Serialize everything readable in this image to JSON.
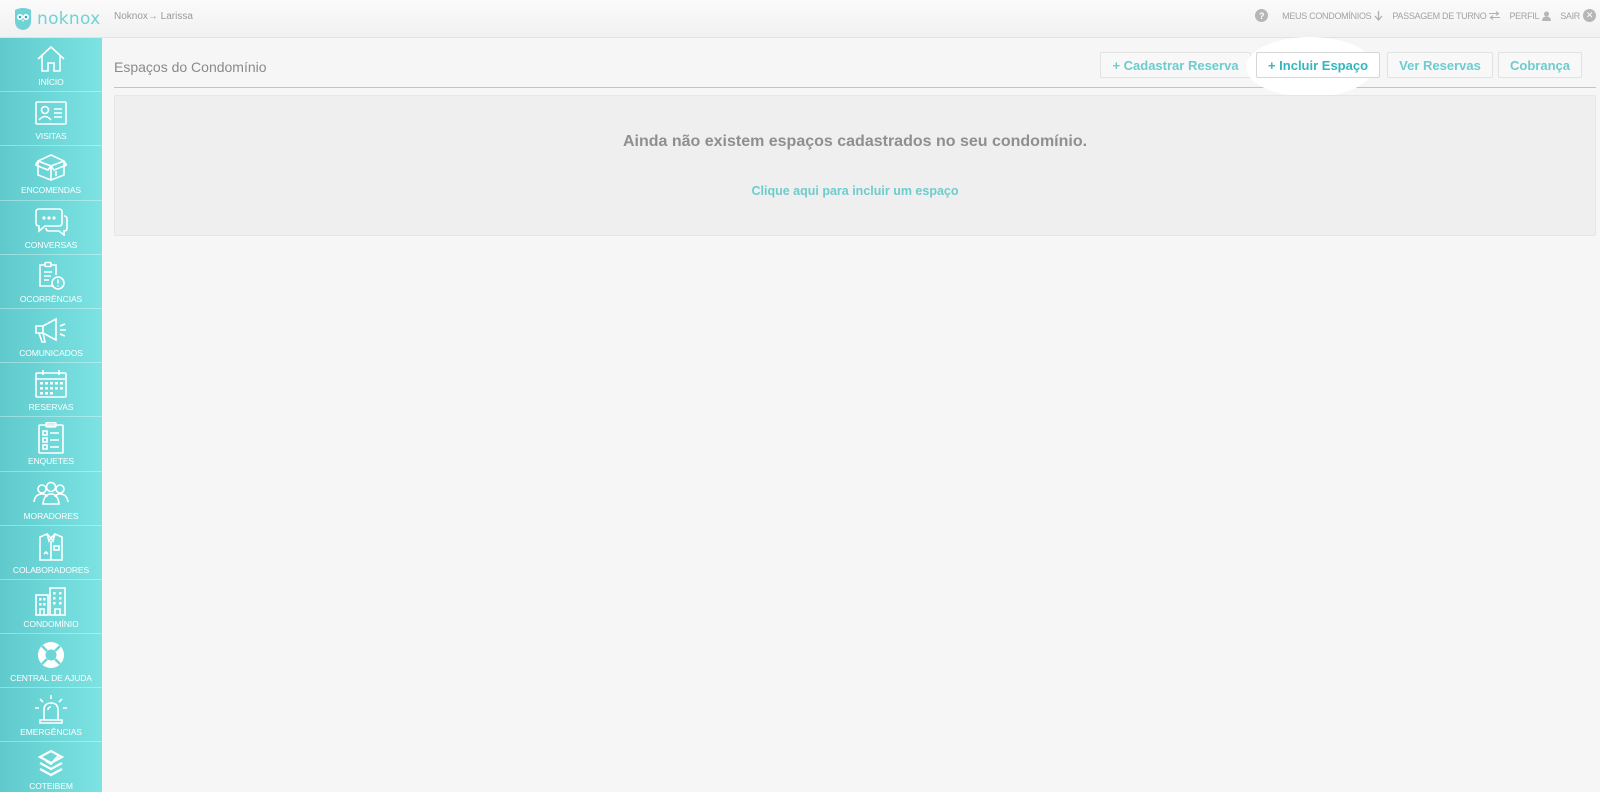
{
  "app": {
    "logo_text": "noknox",
    "breadcrumb": "Noknox→ Larissa"
  },
  "topnav": {
    "help_glyph": "?",
    "meus_condominios": "MEUS CONDOMÍNIOS",
    "passagem_de_turno": "PASSAGEM DE TURNO",
    "perfil": "PERFIL",
    "sair": "SAIR"
  },
  "sidebar": {
    "items": [
      {
        "label": "INÍCIO",
        "icon": "home-icon"
      },
      {
        "label": "VISITAS",
        "icon": "id-card-icon"
      },
      {
        "label": "ENCOMENDAS",
        "icon": "package-icon"
      },
      {
        "label": "CONVERSAS",
        "icon": "chat-icon"
      },
      {
        "label": "OCORRÊNCIAS",
        "icon": "clipboard-alert-icon"
      },
      {
        "label": "COMUNICADOS",
        "icon": "megaphone-icon"
      },
      {
        "label": "RESERVAS",
        "icon": "calendar-icon"
      },
      {
        "label": "ENQUETES",
        "icon": "checklist-icon"
      },
      {
        "label": "MORADORES",
        "icon": "people-icon"
      },
      {
        "label": "COLABORADORES",
        "icon": "staff-icon"
      },
      {
        "label": "CONDOMÍNIO",
        "icon": "building-icon"
      },
      {
        "label": "CENTRAL DE AJUDA",
        "icon": "lifebuoy-icon"
      },
      {
        "label": "EMERGÊNCIAS",
        "icon": "siren-icon"
      },
      {
        "label": "COTEIBEM",
        "icon": "coteibem-icon"
      }
    ]
  },
  "main": {
    "title": "Espaços do Condomínio",
    "buttons": {
      "cadastrar_reserva": "+ Cadastrar Reserva",
      "incluir_espaco": "+ Incluir Espaço",
      "ver_reservas": "Ver Reservas",
      "cobranca": "Cobrança"
    },
    "empty_message": "Ainda não existem espaços cadastrados no seu condomínio.",
    "empty_link": "Clique aqui para incluir um espaço"
  },
  "colors": {
    "accent": "#6dcccd",
    "accent_dark": "#34b7bb",
    "sidebar_start": "#5fc9cc",
    "sidebar_end": "#7de2e2"
  }
}
